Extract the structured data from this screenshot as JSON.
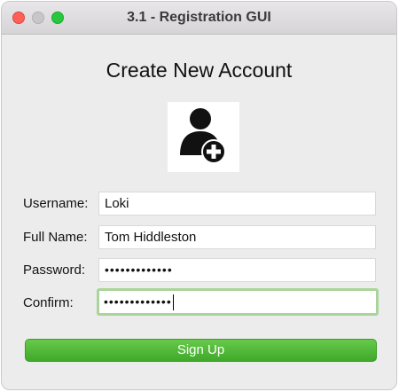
{
  "window": {
    "title": "3.1 - Registration GUI"
  },
  "form": {
    "heading": "Create New Account",
    "avatar_icon": "add-user-icon",
    "username": {
      "label": "Username:",
      "value": "Loki"
    },
    "fullname": {
      "label": "Full Name:",
      "value": "Tom Hiddleston"
    },
    "password": {
      "label": "Password:",
      "value": "•••••••••••••"
    },
    "confirm": {
      "label": "Confirm:",
      "value": "•••••••••••••"
    },
    "signup_label": "Sign Up"
  },
  "colors": {
    "accent_green": "#4cb936",
    "focus_ring": "#a9d59b",
    "close": "#fe5f57",
    "zoom": "#29c73f"
  }
}
